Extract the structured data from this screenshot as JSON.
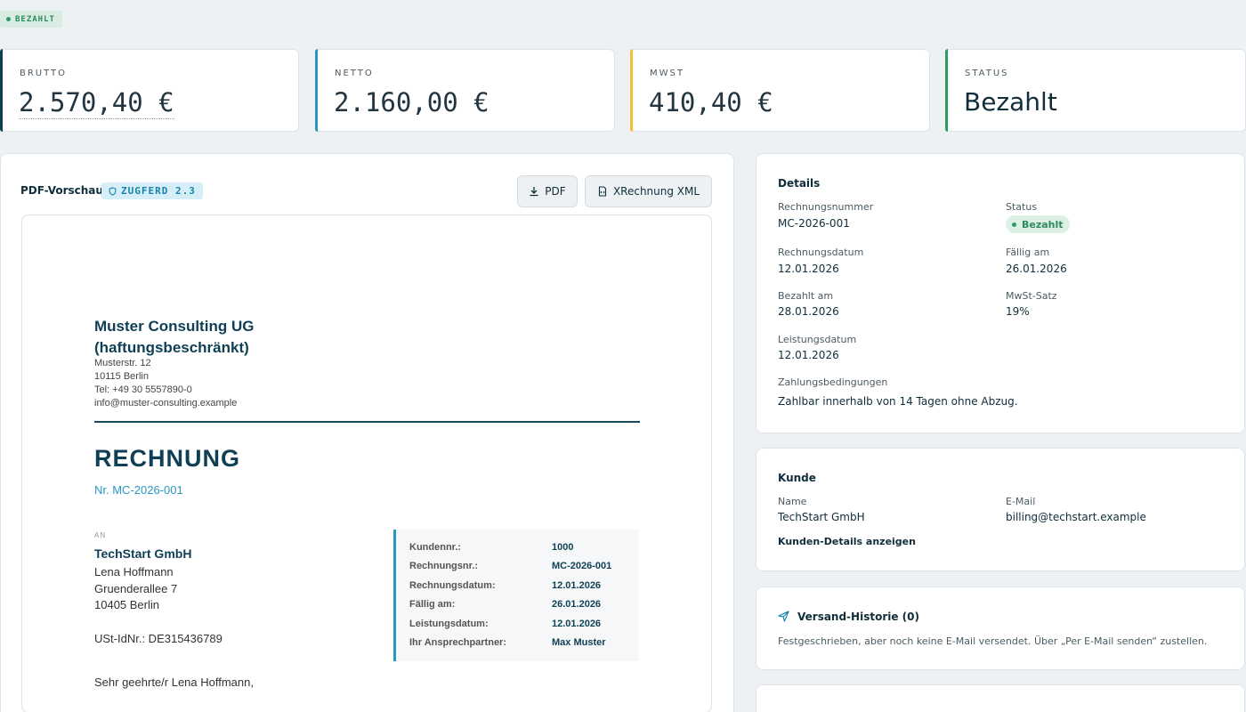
{
  "status_pill": "BEZAHLT",
  "kpis": [
    {
      "label": "BRUTTO",
      "value": "2.570,40 €",
      "color": "#0f3f55"
    },
    {
      "label": "NETTO",
      "value": "2.160,00 €",
      "color": "#2a97c2"
    },
    {
      "label": "MWST",
      "value": "410,40 €",
      "color": "#f2c037"
    },
    {
      "label": "STATUS",
      "value": "Bezahlt",
      "color": "#2e9b63"
    }
  ],
  "preview": {
    "title": "PDF-Vorschau",
    "badge": "ZUGFERD 2.3",
    "btn_pdf": "PDF",
    "btn_xml": "XRechnung XML"
  },
  "doc": {
    "company": "Muster Consulting UG (haftungsbeschränkt)",
    "company_line1": "Muster Consulting UG",
    "company_line2": "(haftungsbeschränkt)",
    "address": [
      "Musterstr. 12",
      "10115 Berlin",
      "Tel: +49 30 5557890-0",
      "info@muster-consulting.example"
    ],
    "title": "RECHNUNG",
    "number": "Nr. MC-2026-001",
    "an": "AN",
    "recipient_name": "TechStart GmbH",
    "recipient_lines": [
      "Lena Hoffmann",
      "Gruenderallee 7",
      "10405 Berlin"
    ],
    "vat_id": "USt-IdNr.: DE315436789",
    "greeting": "Sehr geehrte/r Lena Hoffmann,",
    "meta": [
      {
        "label": "Kundennr.:",
        "value": "1000"
      },
      {
        "label": "Rechnungsnr.:",
        "value": "MC-2026-001"
      },
      {
        "label": "Rechnungsdatum:",
        "value": "12.01.2026"
      },
      {
        "label": "Fällig am:",
        "value": "26.01.2026"
      },
      {
        "label": "Leistungsdatum:",
        "value": "12.01.2026"
      },
      {
        "label": "Ihr Ansprechpartner:",
        "value": "Max Muster"
      }
    ]
  },
  "details": {
    "heading": "Details",
    "invoice_no_label": "Rechnungsnummer",
    "invoice_no": "MC-2026-001",
    "status_label": "Status",
    "status": "Bezahlt",
    "invoice_date_label": "Rechnungsdatum",
    "invoice_date": "12.01.2026",
    "due_label": "Fällig am",
    "due": "26.01.2026",
    "paid_label": "Bezahlt am",
    "paid": "28.01.2026",
    "vat_label": "MwSt-Satz",
    "vat": "19%",
    "service_label": "Leistungsdatum",
    "service": "12.01.2026",
    "terms_label": "Zahlungsbedingungen",
    "terms": "Zahlbar innerhalb von 14 Tagen ohne Abzug."
  },
  "customer": {
    "heading": "Kunde",
    "name_label": "Name",
    "name": "TechStart GmbH",
    "email_label": "E-Mail",
    "email": "billing@techstart.example",
    "link": "Kunden-Details anzeigen"
  },
  "shipping": {
    "heading": "Versand-Historie (0)",
    "text": "Festgeschrieben, aber noch keine E-Mail versendet. Über „Per E-Mail senden“ zustellen."
  }
}
